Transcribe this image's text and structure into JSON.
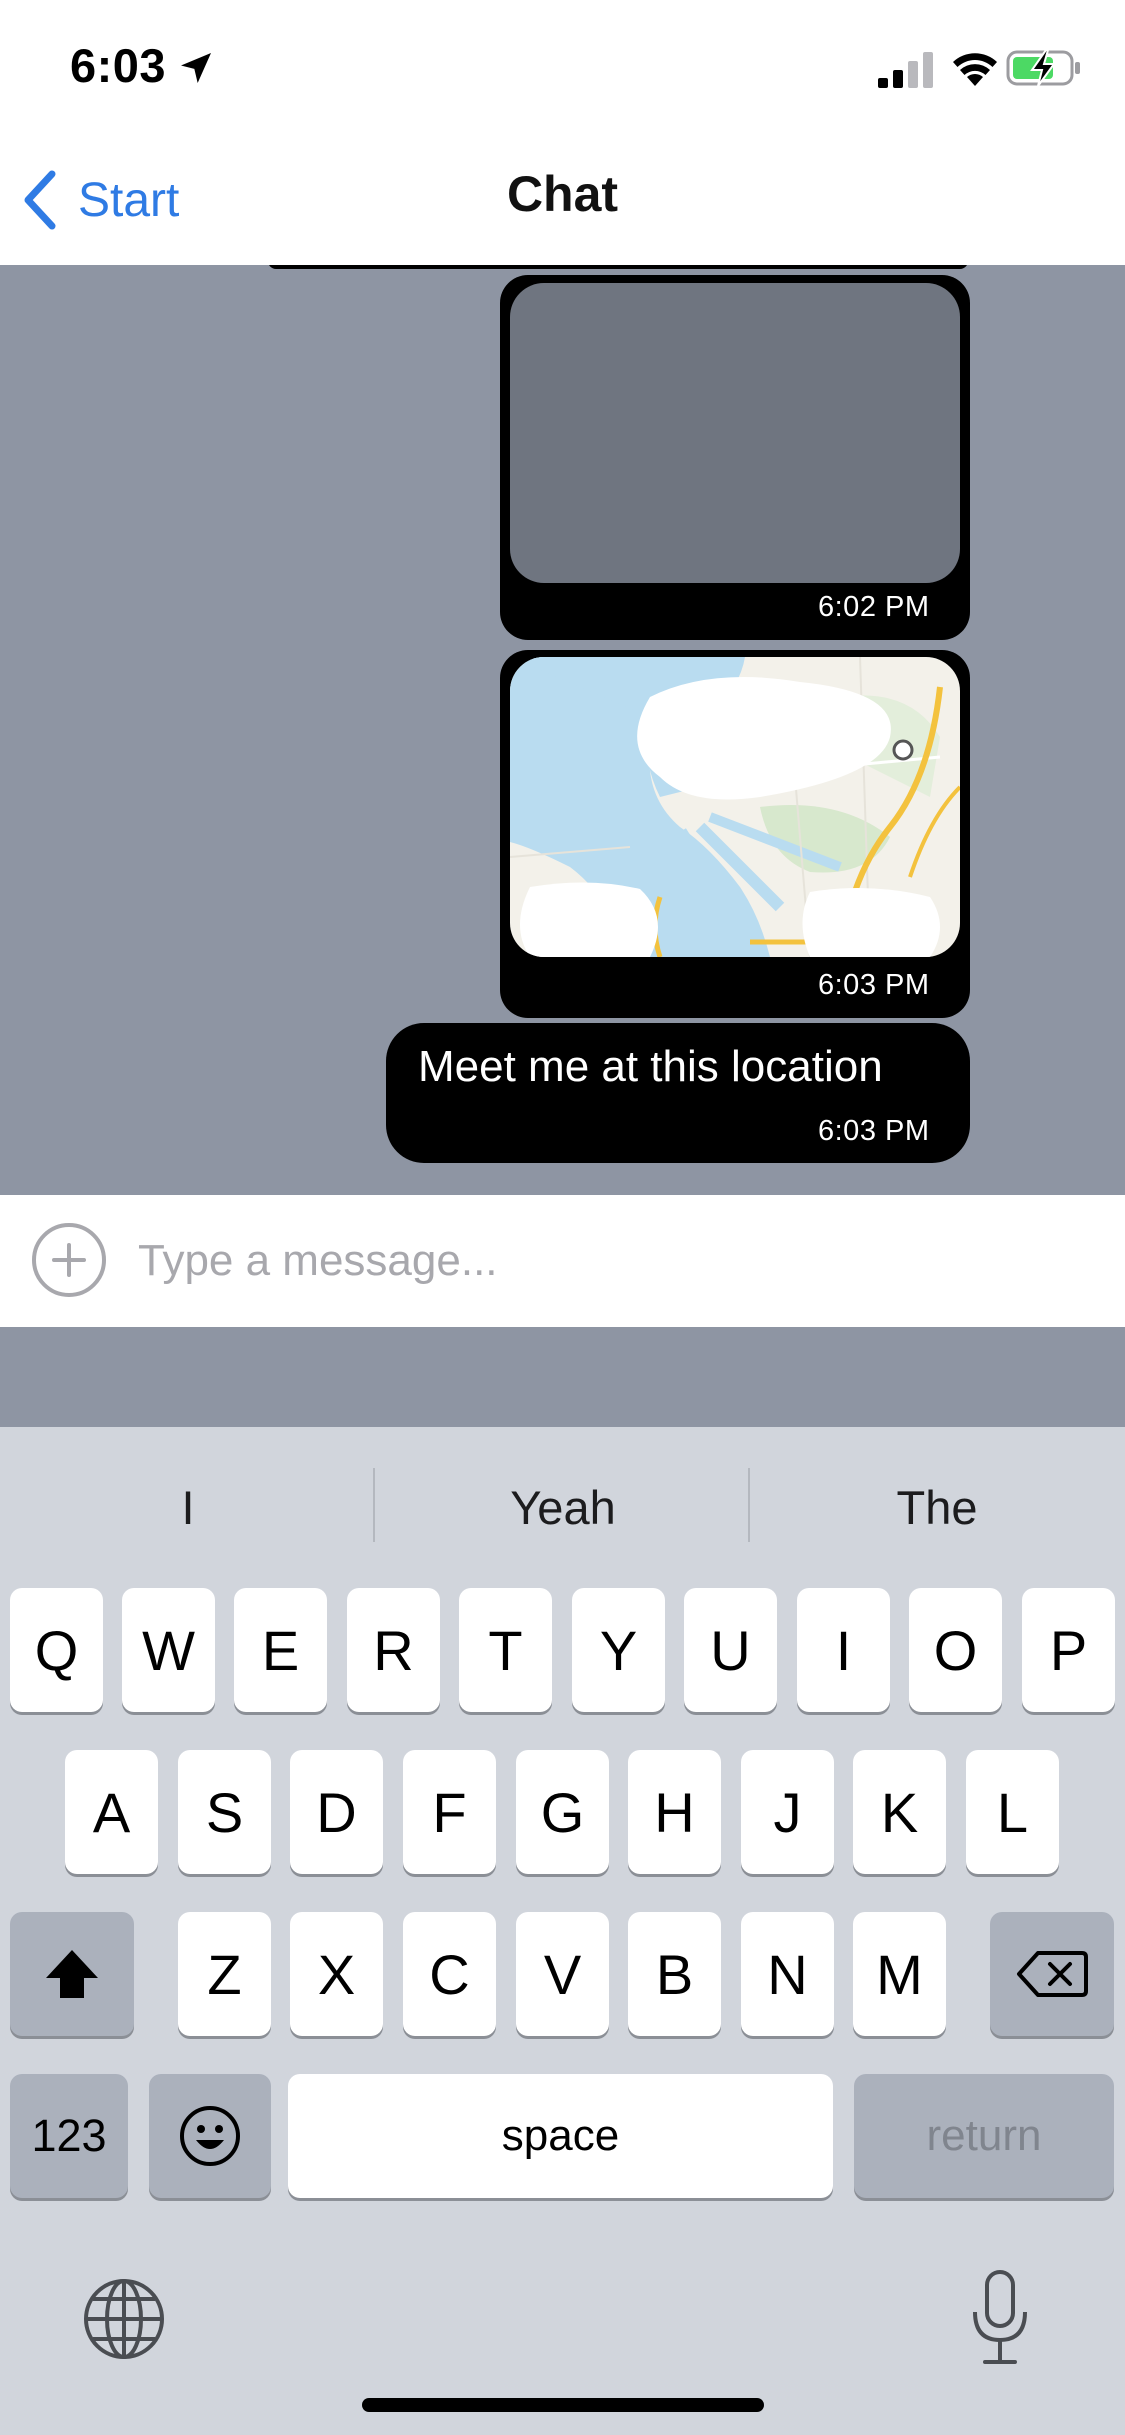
{
  "status_bar": {
    "time": "6:03",
    "icons": [
      "location-arrow-icon",
      "signal-icon",
      "wifi-icon",
      "battery-charging-icon"
    ]
  },
  "nav": {
    "back_label": "Start",
    "title": "Chat"
  },
  "messages": [
    {
      "type": "image",
      "timestamp": "6:02 PM"
    },
    {
      "type": "map",
      "timestamp": "6:03 PM"
    },
    {
      "type": "text",
      "text": "Meet me at this location",
      "timestamp": "6:03 PM"
    }
  ],
  "composer": {
    "placeholder": "Type a message...",
    "value": ""
  },
  "keyboard": {
    "suggestions": [
      "I",
      "Yeah",
      "The"
    ],
    "row1": [
      "Q",
      "W",
      "E",
      "R",
      "T",
      "Y",
      "U",
      "I",
      "O",
      "P"
    ],
    "row2": [
      "A",
      "S",
      "D",
      "F",
      "G",
      "H",
      "J",
      "K",
      "L"
    ],
    "row3": [
      "Z",
      "X",
      "C",
      "V",
      "B",
      "N",
      "M"
    ],
    "numbers_label": "123",
    "space_label": "space",
    "return_label": "return"
  },
  "colors": {
    "accent": "#2f7be4",
    "chat_background": "#8e95a3",
    "bubble": "#000000",
    "keyboard_background": "#d1d5dc"
  }
}
